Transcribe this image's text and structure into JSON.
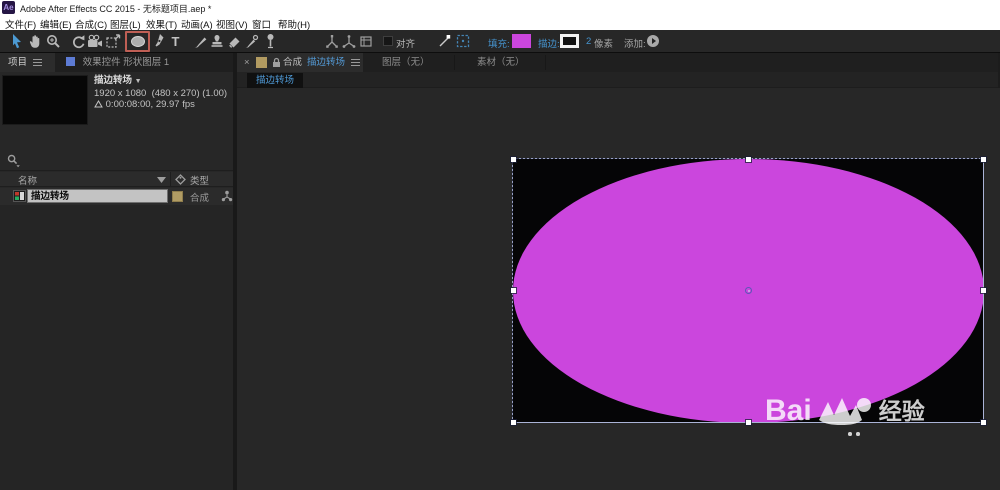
{
  "window": {
    "app_icon": "Ae",
    "title": "Adobe After Effects CC 2015 - 无标题项目.aep *"
  },
  "menubar": {
    "items": [
      {
        "label": "文件(F)"
      },
      {
        "label": "编辑(E)"
      },
      {
        "label": "合成(C)"
      },
      {
        "label": "图层(L)"
      },
      {
        "label": "效果(T)"
      },
      {
        "label": "动画(A)"
      },
      {
        "label": "视图(V)"
      },
      {
        "label": "窗口"
      },
      {
        "label": "帮助(H)"
      }
    ]
  },
  "toolbar": {
    "tools": [
      "selection",
      "hand",
      "zoom",
      "rotate",
      "camera",
      "pan-behind",
      "ellipse",
      "pen",
      "type",
      "brush",
      "stamp",
      "eraser",
      "roto-brush",
      "puppet-pin",
      "axis-local",
      "axis-world",
      "axis-view"
    ],
    "active_tool": "ellipse",
    "snap_label": "对齐",
    "fill_label": "填充:",
    "fill_color": "#cb46dd",
    "stroke_label": "描边:",
    "stroke_color": "#ffffff",
    "stroke_width": "2",
    "stroke_unit": "像素",
    "add_label": "添加:"
  },
  "project_panel": {
    "tab": "项目",
    "effect_controls_tab": "效果控件 形状图层 1",
    "preview": {
      "name": "描边转场",
      "size_line": "1920 x 1080  (480 x 270) (1.00)",
      "duration_line": "0:00:08:00, 29.97 fps"
    },
    "columns": {
      "name": "名称",
      "type": "类型"
    },
    "items": [
      {
        "name": "描边转场",
        "type": "合成",
        "label_color": "#b19c64",
        "selected": true
      }
    ]
  },
  "comp_panel": {
    "active_tab": {
      "close": "×",
      "panel": "合成",
      "comp_name": "描边转场"
    },
    "tabs": [
      {
        "label": "图层（无）"
      },
      {
        "label": "素材（无）"
      }
    ],
    "viewer_tab": "描边转场"
  },
  "viewport": {
    "comp_background": "#050506",
    "ellipse_fill": "#cb46dd",
    "watermark": {
      "prefix": "Bai",
      "suffix": "经验"
    }
  },
  "colors": {
    "accent_blue": "#4f9ad7",
    "highlight_red": "#bf5f55",
    "label_tan": "#b19c64"
  }
}
